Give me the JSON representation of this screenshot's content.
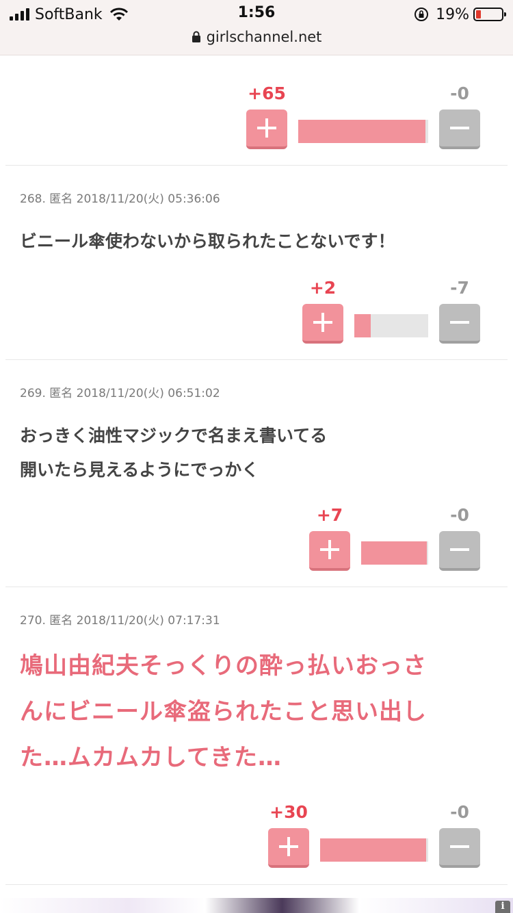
{
  "status_bar": {
    "carrier": "SoftBank",
    "time": "1:56",
    "battery_percent": "19%",
    "battery_level": 0.19
  },
  "url_bar": {
    "url": "girlschannel.net"
  },
  "comments": [
    {
      "plus": "+65",
      "minus": "-0",
      "ratio": 0.98
    },
    {
      "meta": "268. 匿名 2018/11/20(火) 05:36:06",
      "text": "ビニール傘使わないから取られたことないです！",
      "plus": "+2",
      "minus": "-7",
      "ratio": 0.22
    },
    {
      "meta": "269. 匿名 2018/11/20(火) 06:51:02",
      "line1": "おっきく油性マジックで名まえ書いてる",
      "line2": "開いたら見えるようにでっかく",
      "plus": "+7",
      "minus": "-0",
      "ratio": 0.98
    },
    {
      "meta": "270. 匿名 2018/11/20(火) 07:17:31",
      "line1": "鳩山由紀夫そっくりの酔っ払いおっさ",
      "line2": "んにビニール傘盗られたこと思い出し",
      "line3": "た…ムカムカしてきた…",
      "plus": "+30",
      "minus": "-0",
      "ratio": 0.98
    }
  ],
  "ad": {
    "info_label": "i"
  },
  "colors": {
    "plus_accent": "#e84552",
    "plus_button": "#f2929b",
    "minus_button": "#bdbdbd",
    "highlight_text": "#e86a7a"
  }
}
